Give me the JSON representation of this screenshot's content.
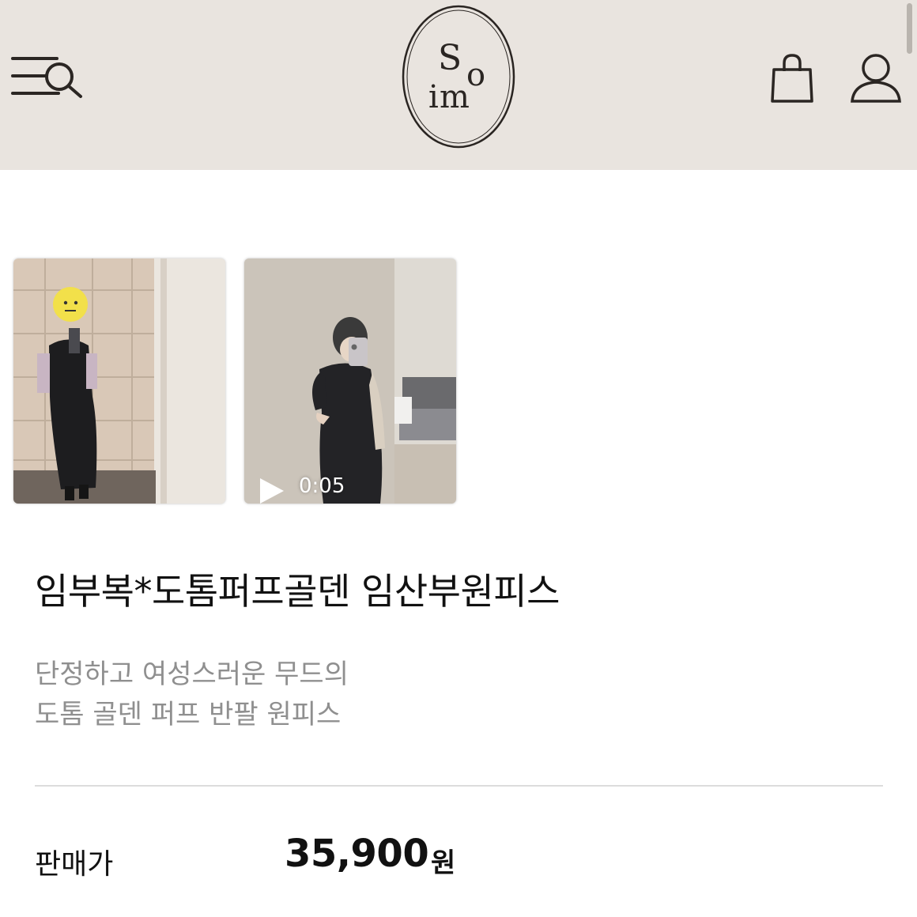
{
  "header": {
    "logo_letters": [
      "S",
      "o",
      "i",
      "m"
    ],
    "background": "#e9e4df",
    "icons": {
      "menu_search": "menu-search-icon",
      "cart": "shopping-bag-icon",
      "account": "user-icon"
    }
  },
  "media": {
    "thumbnails": [
      {
        "type": "photo"
      },
      {
        "type": "video",
        "duration": "0:05"
      }
    ]
  },
  "product": {
    "title": "임부복*도톰퍼프골덴 임산부원피스",
    "description_line1": "단정하고 여성스러운 무드의",
    "description_line2": "도톰 골덴 퍼프 반팔 원피스"
  },
  "price": {
    "label": "판매가",
    "value": "35,900",
    "unit": "원"
  }
}
